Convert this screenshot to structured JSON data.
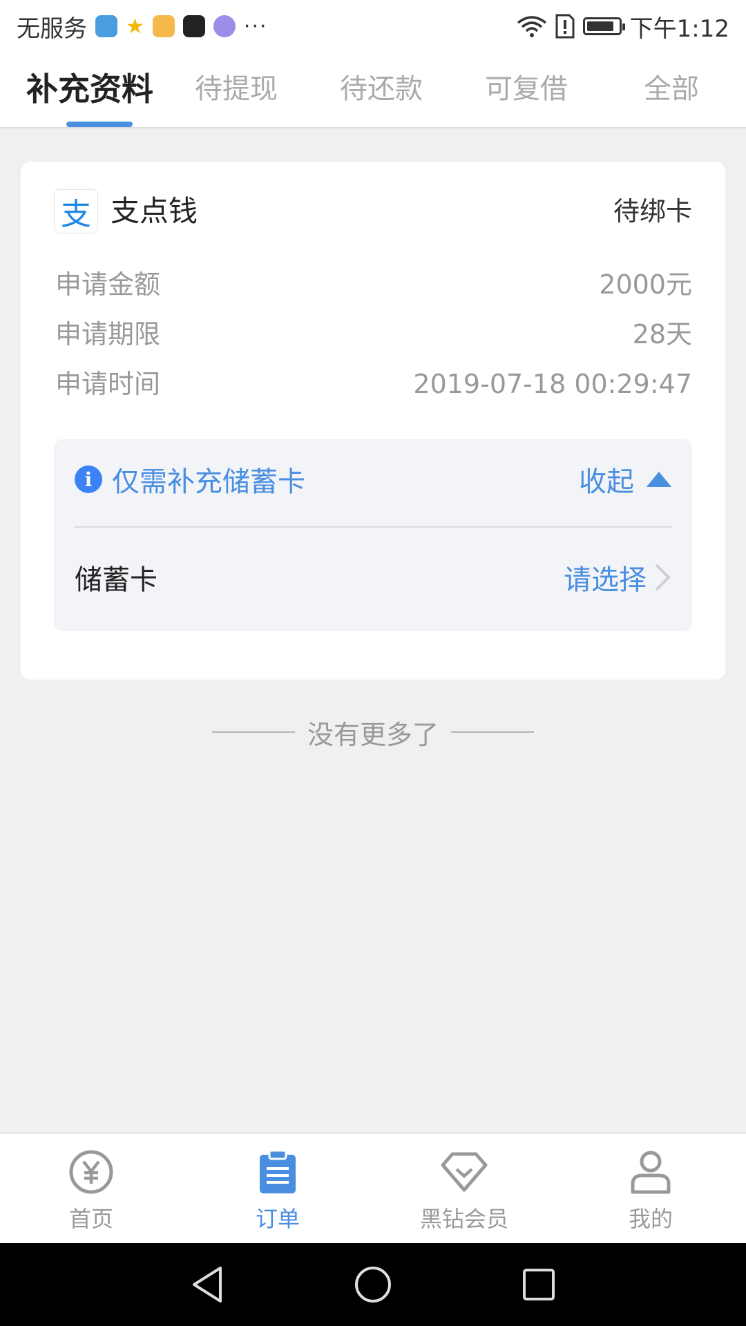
{
  "status_bar": {
    "carrier": "无服务",
    "more": "···",
    "time": "下午1:12"
  },
  "tabs": [
    {
      "label": "补充资料",
      "active": true
    },
    {
      "label": "待提现",
      "active": false
    },
    {
      "label": "待还款",
      "active": false
    },
    {
      "label": "可复借",
      "active": false
    },
    {
      "label": "全部",
      "active": false
    }
  ],
  "card": {
    "brand": "支点钱",
    "logo_glyph": "支",
    "status": "待绑卡",
    "rows": [
      {
        "label": "申请金额",
        "value": "2000元"
      },
      {
        "label": "申请期限",
        "value": "28天"
      },
      {
        "label": "申请时间",
        "value": "2019-07-18 00:29:47"
      }
    ],
    "panel": {
      "tip": "仅需补充储蓄卡",
      "collapse_label": "收起",
      "row_label": "储蓄卡",
      "select_label": "请选择"
    }
  },
  "no_more": "没有更多了",
  "bottom_nav": [
    {
      "label": "首页",
      "icon": "yen-circle-icon",
      "active": false
    },
    {
      "label": "订单",
      "icon": "clipboard-icon",
      "active": true
    },
    {
      "label": "黑钻会员",
      "icon": "diamond-icon",
      "active": false
    },
    {
      "label": "我的",
      "icon": "person-icon",
      "active": false
    }
  ],
  "colors": {
    "accent": "#4a8ee0",
    "background": "#f0f0f1"
  }
}
